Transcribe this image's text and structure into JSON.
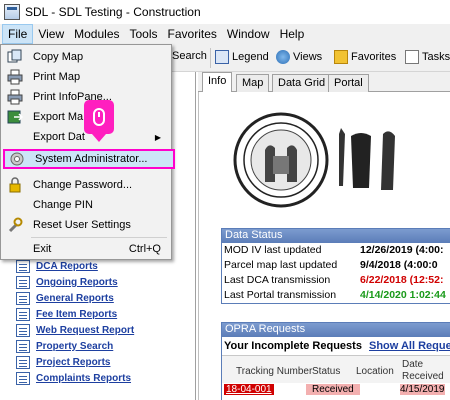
{
  "window": {
    "title": "SDL - SDL Testing - Construction"
  },
  "menubar": [
    "File",
    "View",
    "Modules",
    "Tools",
    "Favorites",
    "Window",
    "Help"
  ],
  "toolbar": {
    "search": "Search",
    "legend": "Legend",
    "views": "Views",
    "favorites": "Favorites",
    "tasks": "Tasks"
  },
  "file_menu": [
    {
      "label": "Copy Map",
      "icon": "copy-map-icon"
    },
    {
      "label": "Print Map",
      "icon": "print-icon"
    },
    {
      "label": "Print InfoPane...",
      "icon": "print-icon"
    },
    {
      "label": "Export Ma",
      "icon": "export-icon"
    },
    {
      "label": "Export Dat",
      "icon": "export-icon",
      "arrow": "▶"
    },
    {
      "label": "System Administrator...",
      "icon": "admin-icon"
    },
    {
      "label": "Change Password...",
      "icon": "lock-icon"
    },
    {
      "label": "Change PIN",
      "icon": ""
    },
    {
      "label": "Reset User Settings",
      "icon": "wrench-icon"
    },
    {
      "label": "Exit",
      "shortcut": "Ctrl+Q",
      "icon": ""
    }
  ],
  "side_links": [
    "DCA Reports",
    "Ongoing Reports",
    "General Reports",
    "Fee Item Reports",
    "Web Request Report",
    "Property Search",
    "Project Reports",
    "Complaints Reports"
  ],
  "tabs": [
    "Info",
    "Map",
    "Data Grid",
    "Portal"
  ],
  "data_status": {
    "title": "Data Status",
    "rows": [
      {
        "label": "MOD IV last updated",
        "value": "12/26/2019 (4:00:",
        "color": "#000000"
      },
      {
        "label": "Parcel map last updated",
        "value": "9/4/2018 (4:00:0",
        "color": "#000000"
      },
      {
        "label": "Last DCA transmission",
        "value": "6/22/2018 (12:52:",
        "color": "#d00000"
      },
      {
        "label": "Last Portal transmission",
        "value": "4/14/2020 1:02:44",
        "color": "#1a9a1a"
      }
    ]
  },
  "opra": {
    "title": "OPRA Requests",
    "subtitle": "Your Incomplete Requests",
    "show_all": "Show All Reques",
    "columns": [
      "Tracking Number",
      "Status",
      "Location",
      "Date Received"
    ],
    "row": {
      "tracking": "18-04-001",
      "status": "Received",
      "date": "4/15/2019"
    }
  }
}
